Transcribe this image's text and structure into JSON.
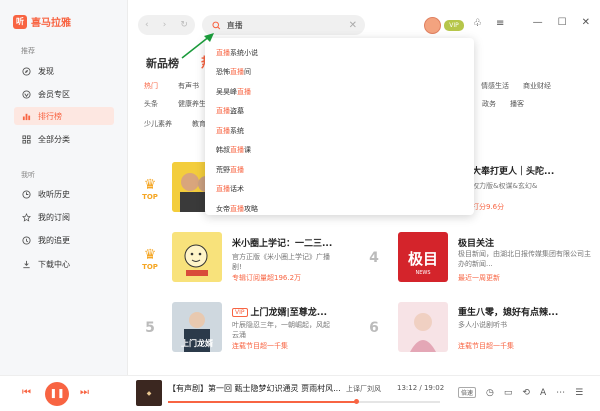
{
  "app": {
    "name": "喜马拉雅",
    "logo_char": "听"
  },
  "sidebar": {
    "section1": "推荐",
    "items": [
      {
        "label": "发现",
        "icon": "compass-icon"
      },
      {
        "label": "会员专区",
        "icon": "vip-icon"
      },
      {
        "label": "排行榜",
        "icon": "ranking-icon"
      },
      {
        "label": "全部分类",
        "icon": "grid-icon"
      }
    ],
    "section2": "我听",
    "items2": [
      {
        "label": "收听历史",
        "icon": "clock-icon"
      },
      {
        "label": "我的订阅",
        "icon": "star-icon"
      },
      {
        "label": "我的追更",
        "icon": "refresh-icon"
      },
      {
        "label": "下载中心",
        "icon": "download-icon"
      }
    ],
    "active_color": "#f86442"
  },
  "search": {
    "value": "直播"
  },
  "header": {
    "vip_badge": "VIP"
  },
  "content": {
    "tabs": [
      "新品榜",
      "热销"
    ],
    "cat_row1": [
      "热门",
      "有声书"
    ],
    "cat_row1_right": [
      "情感生活",
      "商业财经"
    ],
    "cat_row2": [
      "头条",
      "健康养生"
    ],
    "cat_row2_right": [
      "政务",
      "播客"
    ],
    "cat_row3": [
      "少儿素养",
      "教育"
    ]
  },
  "dropdown": [
    {
      "hl": "直播",
      "rest": "系统小说",
      "pre": ""
    },
    {
      "pre": "恐怖",
      "hl": "直播",
      "rest": "间"
    },
    {
      "pre": "吴昊峰",
      "hl": "直播",
      "rest": ""
    },
    {
      "pre": "",
      "hl": "直播",
      "rest": "盗墓"
    },
    {
      "pre": "",
      "hl": "直播",
      "rest": "系统"
    },
    {
      "pre": "韩叔",
      "hl": "直播",
      "rest": "课"
    },
    {
      "pre": "荒野",
      "hl": "直播",
      "rest": ""
    },
    {
      "pre": "",
      "hl": "直播",
      "rest": "话术"
    },
    {
      "pre": "女帝",
      "hl": "直播",
      "rest": "攻略"
    }
  ],
  "ranking": [
    {
      "rank_label": "TOP",
      "title": "",
      "desc": "",
      "meta": ""
    },
    {
      "rank_label": "",
      "title": "大奉打更人｜头陀...",
      "desc": "权力版&权谋&玄幻&",
      "meta": "打分9.6分"
    },
    {
      "rank_label": "TOP",
      "title": "米小圈上学记：一二三...",
      "desc": "官方正版《米小圈上学记》广播剧!",
      "meta": "专辑订阅量超196.2万"
    },
    {
      "rank": "4",
      "title": "极目关注",
      "desc": "极目新闻，由湖北日报传媒集团有限公司主办的新闻...",
      "meta": "最近一周更新"
    },
    {
      "rank": "5",
      "vip": "VIP",
      "title": "上门龙婿|至尊龙...",
      "desc": "叶辰隐忍三年，一朝崛起，风起云涌",
      "meta": "连载节目超一千集"
    },
    {
      "rank": "6",
      "title": "重生八零，媳好有点辣...",
      "desc": "多人小说剧听书",
      "meta": "连载节目超一千集"
    }
  ],
  "player": {
    "title": "【有声剧】第一回  甄士隐梦幻识通灵 贾雨村风...",
    "artist": "上译厂刘风",
    "time": "13:12 / 19:02",
    "progress": 0.69,
    "speed_chip": "倍速"
  }
}
